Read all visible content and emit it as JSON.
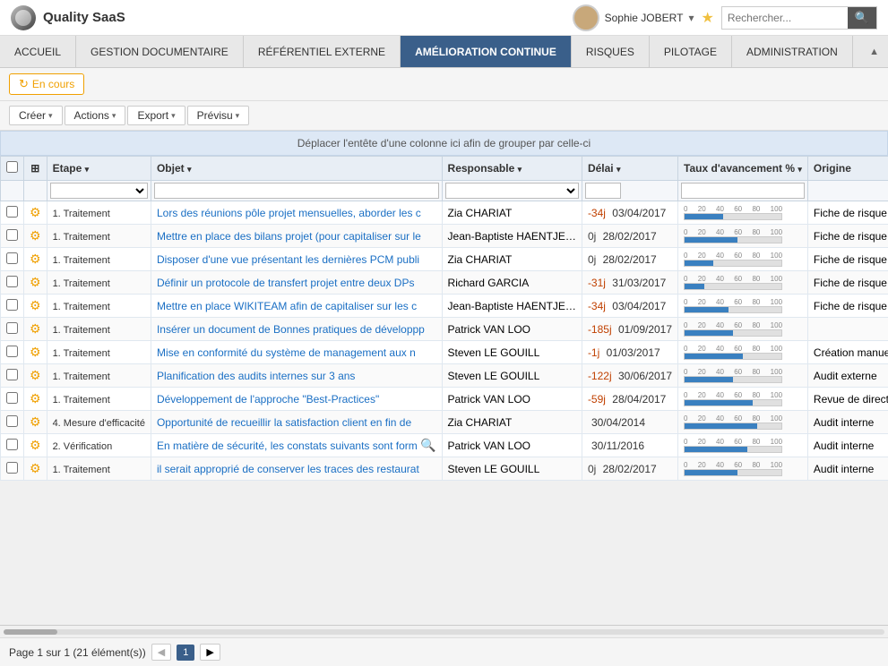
{
  "app": {
    "name": "Quality SaaS"
  },
  "header": {
    "user": "Sophie JOBERT",
    "search_placeholder": "Rechercher..."
  },
  "nav": {
    "items": [
      {
        "label": "ACCUEIL",
        "active": false
      },
      {
        "label": "GESTION DOCUMENTAIRE",
        "active": false
      },
      {
        "label": "RÉFÉRENTIEL EXTERNE",
        "active": false
      },
      {
        "label": "AMÉLIORATION CONTINUE",
        "active": true
      },
      {
        "label": "RISQUES",
        "active": false
      },
      {
        "label": "PILOTAGE",
        "active": false
      },
      {
        "label": "ADMINISTRATION",
        "active": false
      }
    ]
  },
  "subtoolbar": {
    "status_label": "En cours"
  },
  "toolbar": {
    "create_label": "Créer",
    "actions_label": "Actions",
    "export_label": "Export",
    "preview_label": "Prévisu"
  },
  "group_header": {
    "text": "Déplacer l'entête d'une colonne ici afin de grouper par celle-ci"
  },
  "table": {
    "columns": [
      {
        "id": "check",
        "label": ""
      },
      {
        "id": "expand",
        "label": ""
      },
      {
        "id": "etape",
        "label": "Etape"
      },
      {
        "id": "objet",
        "label": "Objet"
      },
      {
        "id": "responsable",
        "label": "Responsable"
      },
      {
        "id": "delai",
        "label": "Délai"
      },
      {
        "id": "taux",
        "label": "Taux d'avancement %"
      },
      {
        "id": "origine",
        "label": "Origine"
      }
    ],
    "rows": [
      {
        "step_num": "1.",
        "step_name": "Traitement",
        "objet": "Lors des réunions pôle projet mensuelles, aborder les c",
        "responsable": "Zia CHARIAT",
        "delai": "-34j",
        "delai_type": "neg",
        "date": "03/04/2017",
        "progress": 40,
        "origine": "Fiche de risque",
        "has_search": false
      },
      {
        "step_num": "1.",
        "step_name": "Traitement",
        "objet": "Mettre en place des bilans projet (pour capitaliser sur le",
        "responsable": "Jean-Baptiste HAENTJE…",
        "delai": "0j",
        "delai_type": "zero",
        "date": "28/02/2017",
        "progress": 55,
        "origine": "Fiche de risque",
        "has_search": false
      },
      {
        "step_num": "1.",
        "step_name": "Traitement",
        "objet": "Disposer d'une vue présentant les dernières PCM publi",
        "responsable": "Zia CHARIAT",
        "delai": "0j",
        "delai_type": "zero",
        "date": "28/02/2017",
        "progress": 30,
        "origine": "Fiche de risque",
        "has_search": false
      },
      {
        "step_num": "1.",
        "step_name": "Traitement",
        "objet": "Définir un protocole de transfert projet entre deux DPs",
        "responsable": "Richard GARCIA",
        "delai": "-31j",
        "delai_type": "neg",
        "date": "31/03/2017",
        "progress": 20,
        "origine": "Fiche de risque",
        "has_search": false
      },
      {
        "step_num": "1.",
        "step_name": "Traitement",
        "objet": "Mettre en place WIKITEAM afin de capitaliser sur les c",
        "responsable": "Jean-Baptiste HAENTJE…",
        "delai": "-34j",
        "delai_type": "neg",
        "date": "03/04/2017",
        "progress": 45,
        "origine": "Fiche de risque",
        "has_search": false
      },
      {
        "step_num": "1.",
        "step_name": "Traitement",
        "objet": "Insérer un document de Bonnes pratiques de développp",
        "responsable": "Patrick VAN LOO",
        "delai": "-185j",
        "delai_type": "neg",
        "date": "01/09/2017",
        "progress": 50,
        "origine": "",
        "has_search": false
      },
      {
        "step_num": "1.",
        "step_name": "Traitement",
        "objet": "Mise en conformité du système de management aux n",
        "responsable": "Steven LE GOUILL",
        "delai": "-1j",
        "delai_type": "neg",
        "date": "01/03/2017",
        "progress": 60,
        "origine": "Création manuelle",
        "has_search": false
      },
      {
        "step_num": "1.",
        "step_name": "Traitement",
        "objet": "Planification des audits internes sur 3 ans",
        "responsable": "Steven LE GOUILL",
        "delai": "-122j",
        "delai_type": "neg",
        "date": "30/06/2017",
        "progress": 50,
        "origine": "Audit externe",
        "has_search": false
      },
      {
        "step_num": "1.",
        "step_name": "Traitement",
        "objet": "Développement de l'approche \"Best-Practices\"",
        "responsable": "Patrick VAN LOO",
        "delai": "-59j",
        "delai_type": "neg",
        "date": "28/04/2017",
        "progress": 70,
        "origine": "Revue de direction",
        "has_search": false
      },
      {
        "step_num": "4.",
        "step_name": "Mesure d'efficacité",
        "objet": "Opportunité de recueillir la satisfaction client en fin de",
        "responsable": "Zia CHARIAT",
        "delai": "",
        "delai_type": "zero",
        "date": "30/04/2014",
        "progress": 75,
        "origine": "Audit interne",
        "has_search": false
      },
      {
        "step_num": "2.",
        "step_name": "Vérification",
        "objet": "En matière de sécurité, les constats suivants sont form",
        "responsable": "Patrick VAN LOO",
        "delai": "",
        "delai_type": "zero",
        "date": "30/11/2016",
        "progress": 65,
        "origine": "Audit interne",
        "has_search": true
      },
      {
        "step_num": "1.",
        "step_name": "Traitement",
        "objet": "il serait approprié de conserver les traces des restaurat",
        "responsable": "Steven LE GOUILL",
        "delai": "0j",
        "delai_type": "zero",
        "date": "28/02/2017",
        "progress": 55,
        "origine": "Audit interne",
        "has_search": false
      }
    ]
  },
  "footer": {
    "page_info": "Page 1 sur 1 (21 élément(s))",
    "current_page": "1"
  }
}
